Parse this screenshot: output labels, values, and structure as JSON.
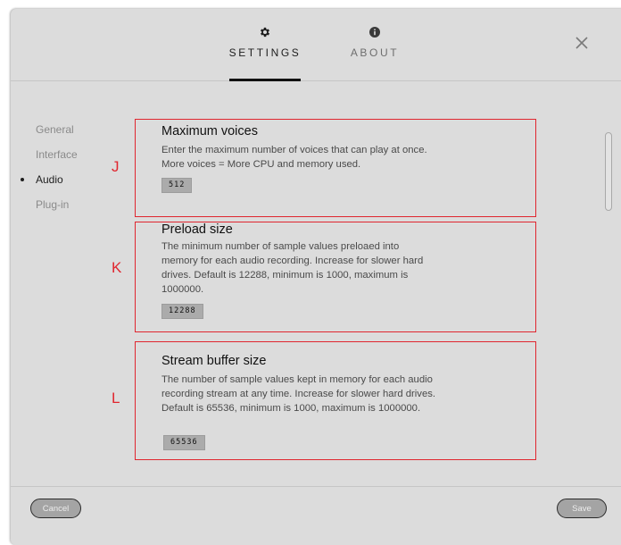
{
  "tabs": [
    {
      "label": "SETTINGS",
      "icon": "gear-icon",
      "active": true
    },
    {
      "label": "ABOUT",
      "icon": "info-icon",
      "active": false
    }
  ],
  "nav": {
    "items": [
      {
        "label": "General",
        "active": false
      },
      {
        "label": "Interface",
        "active": false
      },
      {
        "label": "Audio",
        "active": true
      },
      {
        "label": "Plug-in",
        "active": false
      }
    ]
  },
  "sections": [
    {
      "letter": "J",
      "title": "Maximum voices",
      "description": "Enter the maximum number of voices that can play at once. More voices = More CPU and memory used.",
      "value": "512"
    },
    {
      "letter": "K",
      "title": "Preload size",
      "description": "The minimum number of sample values preloaed into memory for each audio recording. Increase for slower hard drives. Default is 12288, minimum is 1000, maximum is 1000000.",
      "value": "12288"
    },
    {
      "letter": "L",
      "title": "Stream buffer size",
      "description": "The number of sample values kept in memory for each audio recording stream at any time. Increase for slower hard drives. Default is 65536, minimum is 1000, maximum is 1000000.",
      "value": "65536"
    }
  ],
  "footer": {
    "cancel_label": "Cancel",
    "save_label": "Save"
  },
  "colors": {
    "annotation": "#e0262f",
    "background": "#dcdcdc"
  }
}
